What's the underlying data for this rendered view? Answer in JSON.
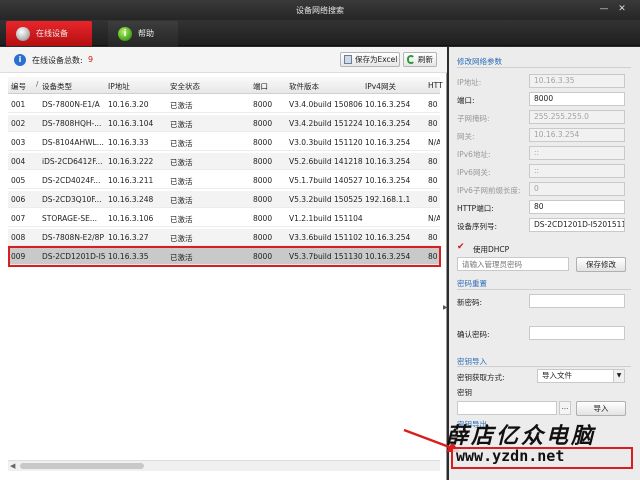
{
  "window": {
    "title": "设备网络搜索",
    "min_glyph": "—",
    "close_glyph": "✕"
  },
  "tabs": [
    {
      "label": "在线设备",
      "icon": "device-search-icon",
      "active": true
    },
    {
      "label": "帮助",
      "icon": "info-icon",
      "active": false
    }
  ],
  "toolbar": {
    "total_label": "在线设备总数:",
    "total_count": "9",
    "export_label": "保存为Excel",
    "refresh_label": "刷新"
  },
  "table": {
    "columns": [
      "编号",
      "设备类型",
      "IP地址",
      "安全状态",
      "端口",
      "软件版本",
      "IPv4网关",
      "HTT"
    ],
    "sort_mark": "/",
    "rows": [
      [
        "001",
        "DS-7800N-E1/A",
        "10.16.3.20",
        "已激活",
        "8000",
        "V3.4.0build 150806",
        "10.16.3.254",
        "80"
      ],
      [
        "002",
        "DS-7808HQH-...",
        "10.16.3.104",
        "已激活",
        "8000",
        "V3.4.2build 151224",
        "10.16.3.254",
        "80"
      ],
      [
        "003",
        "DS-8104AHWL...",
        "10.16.3.33",
        "已激活",
        "8000",
        "V3.0.3build 151120",
        "10.16.3.254",
        "N/A"
      ],
      [
        "004",
        "iDS-2CD6412F...",
        "10.16.3.222",
        "已激活",
        "8000",
        "V5.2.6build 141218",
        "10.16.3.254",
        "80"
      ],
      [
        "005",
        "DS-2CD4024F...",
        "10.16.3.211",
        "已激活",
        "8000",
        "V5.1.7build 140527",
        "10.16.3.254",
        "80"
      ],
      [
        "006",
        "DS-2CD3Q10F...",
        "10.16.3.248",
        "已激活",
        "8000",
        "V5.3.2build 150525",
        "192.168.1.1",
        "80"
      ],
      [
        "007",
        "STORAGE-SE...",
        "10.16.3.106",
        "已激活",
        "8000",
        "V1.2.1build 151104",
        "",
        "N/A"
      ],
      [
        "008",
        "DS-7808N-E2/8P",
        "10.16.3.27",
        "已激活",
        "8000",
        "V3.3.6build 151102",
        "10.16.3.254",
        "80"
      ],
      [
        "009",
        "DS-2CD1201D-I5",
        "10.16.3.35",
        "已激活",
        "8000",
        "V5.3.7build 151130",
        "10.16.3.254",
        "80"
      ]
    ],
    "selected_index": 8
  },
  "network": {
    "section_title": "修改网络参数",
    "fields": [
      {
        "label": "IP地址:",
        "value": "10.16.3.35",
        "readonly": true
      },
      {
        "label": "端口:",
        "value": "8000",
        "readonly": false
      },
      {
        "label": "子网掩码:",
        "value": "255.255.255.0",
        "readonly": true
      },
      {
        "label": "网关:",
        "value": "10.16.3.254",
        "readonly": true
      },
      {
        "label": "IPv6地址:",
        "value": "::",
        "readonly": true
      },
      {
        "label": "IPv6网关:",
        "value": "::",
        "readonly": true
      },
      {
        "label": "IPv6子网前缀长度:",
        "value": "0",
        "readonly": true
      },
      {
        "label": "HTTP端口:",
        "value": "80",
        "readonly": false
      },
      {
        "label": "设备序列号:",
        "value": "DS-2CD1201D-I52015110",
        "readonly": false
      }
    ],
    "dhcp_label": "使用DHCP",
    "dhcp_checked": true,
    "password_placeholder": "请输入管理员密码",
    "save_label": "保存修改"
  },
  "password_reset": {
    "section_title": "密码重置",
    "new_label": "新密码:",
    "confirm_label": "确认密码:"
  },
  "key_import": {
    "section_title": "密钥导入",
    "mode_label": "密钥获取方式:",
    "mode_value": "导入文件",
    "key_label": "密钥",
    "browse_label": "...",
    "import_label": "导入",
    "export_partial": "密钥导出"
  },
  "watermark": {
    "name": "薛店亿众电脑",
    "url": "www.yzdn.net"
  }
}
